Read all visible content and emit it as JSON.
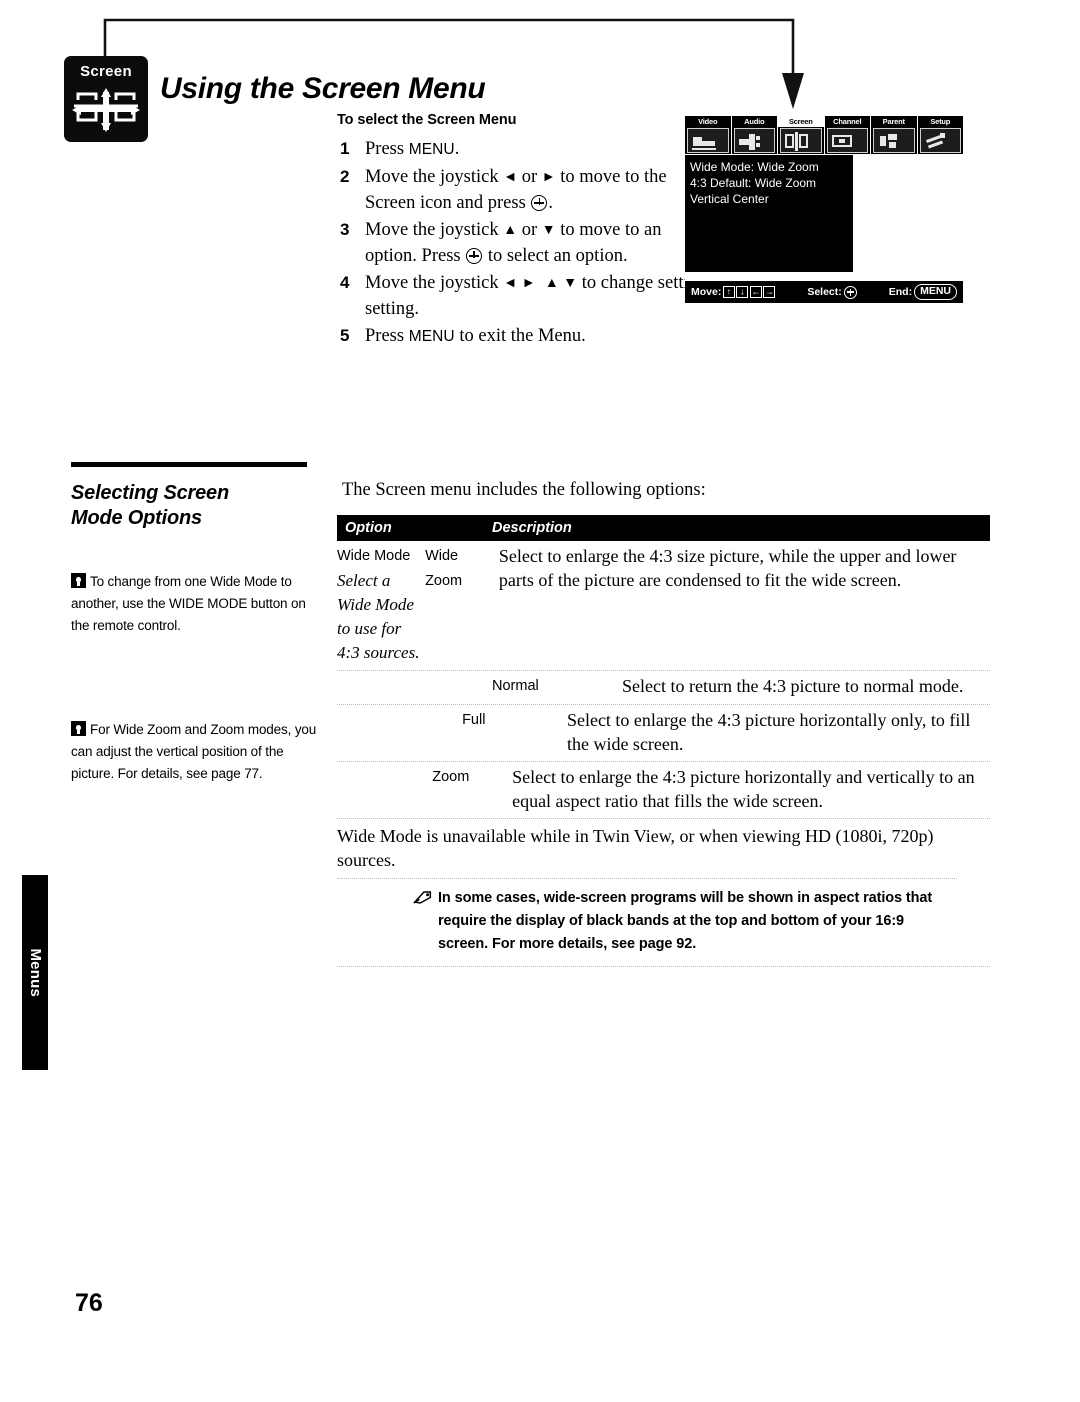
{
  "page": {
    "number": "76",
    "side_tab_label": "Menus"
  },
  "header": {
    "icon_word": "Screen",
    "icon_name": "screen-menu-icon",
    "title": "Using the Screen Menu"
  },
  "procedure": {
    "heading": "To select the Screen Menu",
    "steps": [
      {
        "num": "1",
        "parts": [
          "Press ",
          "MENU",
          "."
        ]
      },
      {
        "num": "2",
        "parts": [
          "Move the joystick ",
          "⮜",
          " or ",
          "⮞",
          " to move to the Screen icon and press ",
          "⊕",
          "."
        ]
      },
      {
        "num": "3",
        "parts": [
          "Move the joystick ",
          "⮝",
          " or ",
          "⮟",
          " to move to an option. Press ",
          "⊕",
          " to select an option."
        ]
      },
      {
        "num": "4",
        "parts": [
          "Move the joystick ",
          "⮜ ⮞ ⮝ ⮟",
          " to change settings. Press ",
          "⊕",
          " to select the changed setting."
        ]
      },
      {
        "num": "5",
        "parts": [
          "Press ",
          "MENU",
          " to exit the Menu."
        ]
      }
    ],
    "step1_pre": "Press ",
    "step1_kbd": "MENU",
    "step1_post": ".",
    "step2_a": "Move the joystick ",
    "step2_or": " or ",
    "step2_b": " to move to the Screen icon and press ",
    "step2_end": ".",
    "step3_a": "Move the joystick ",
    "step3_or": " or ",
    "step3_b": " to move to an option. Press ",
    "step3_c": " to select an option.",
    "step4_a": "Move the joystick ",
    "step4_b": " to change settings. Press ",
    "step4_c": " to select the changed setting.",
    "step5_pre": "Press ",
    "step5_kbd": "MENU",
    "step5_post": " to exit the Menu."
  },
  "tv_menu": {
    "tabs": [
      {
        "label": "Video",
        "active": false
      },
      {
        "label": "Audio",
        "active": false
      },
      {
        "label": "Screen",
        "active": true
      },
      {
        "label": "Channel",
        "active": false
      },
      {
        "label": "Parent",
        "active": false
      },
      {
        "label": "Setup",
        "active": false
      }
    ],
    "body_lines": [
      "Wide Mode: Wide Zoom",
      "4:3 Default: Wide Zoom",
      "Vertical Center"
    ],
    "footer": {
      "move_label": "Move:",
      "move_keys": [
        "↑",
        "↓",
        "←",
        "→"
      ],
      "select_label": "Select:",
      "end_label": "End:",
      "end_button": "MENU"
    }
  },
  "sidebar": {
    "heading": "Selecting Screen\nMode Options",
    "heading_line1": "Selecting Screen",
    "heading_line2": "Mode Options",
    "notes": [
      "To change from one Wide Mode to another, use the WIDE MODE button on the remote control.",
      "For Wide Zoom and Zoom modes, you can adjust the vertical position of the picture. For details, see page 77."
    ]
  },
  "main": {
    "intro": "The Screen menu includes the following options:",
    "table": {
      "headers": [
        "Option",
        "Description"
      ],
      "rows": [
        {
          "option": "Wide Mode",
          "option_note": "Select a Wide Mode to use for 4:3 sources.",
          "value": "Wide Zoom",
          "description": "Select to enlarge the 4:3 size picture, while the upper and lower parts of the picture are condensed to fit the wide screen."
        },
        {
          "option": "",
          "option_note": "",
          "value": "Normal",
          "description": "Select to return the 4:3 picture to normal mode."
        },
        {
          "option": "",
          "option_note": "",
          "value": "Full",
          "description": "Select to enlarge the 4:3 picture horizontally only, to fill the wide screen."
        },
        {
          "option": "",
          "option_note": "",
          "value": "Zoom",
          "description": "Select to enlarge the 4:3 picture horizontally and vertically to an equal aspect ratio that fills the wide screen."
        }
      ],
      "footnote": "Wide Mode is unavailable while in Twin View, or when viewing HD (1080i, 720p) sources."
    },
    "caution": {
      "icon_name": "note-pencil-icon",
      "text": "In some cases, wide-screen programs will be shown in aspect ratios that require the display of black bands at the top and bottom of your 16:9 screen. For more details, see page 92."
    }
  },
  "colors": {
    "ink": "#000000",
    "paper": "#ffffff",
    "rule": "#b9b9b9"
  }
}
